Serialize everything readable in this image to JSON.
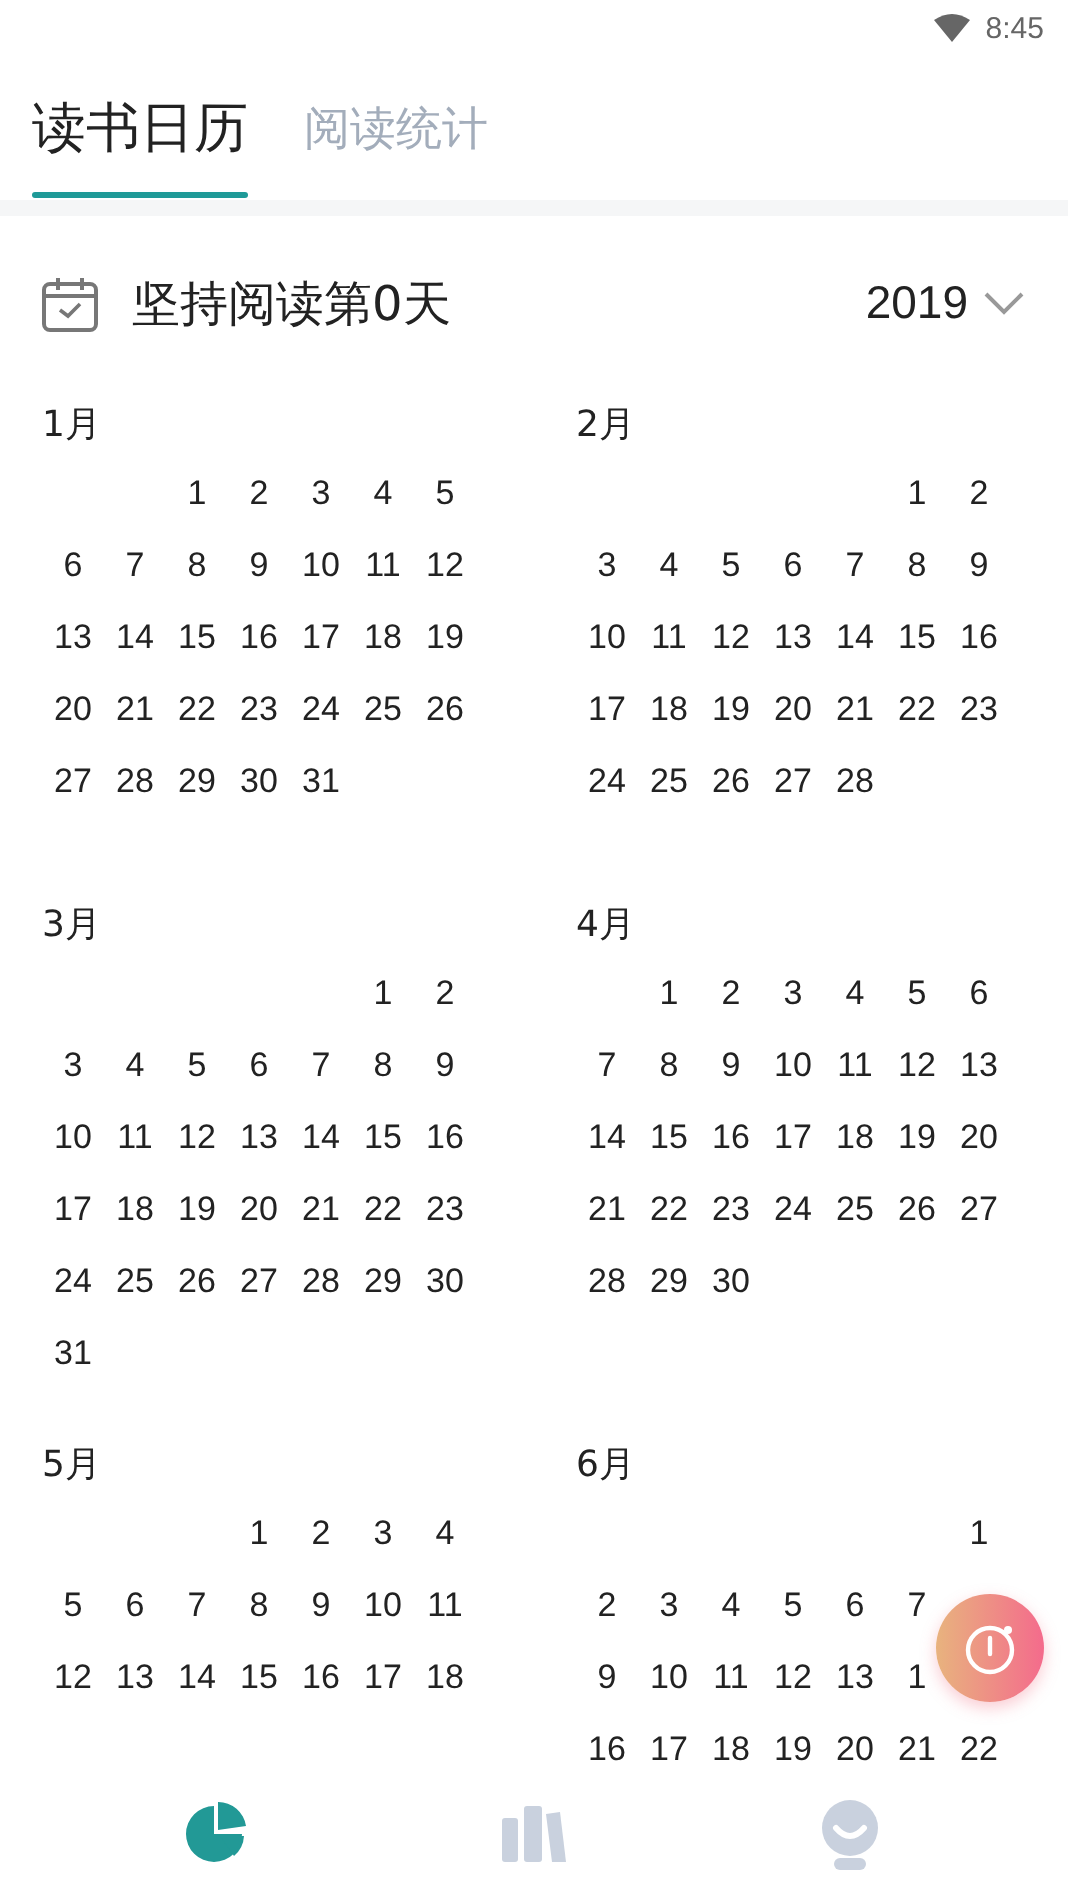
{
  "status_bar": {
    "time": "8:45"
  },
  "tabs": [
    {
      "label": "读书日历",
      "selected": true
    },
    {
      "label": "阅读统计",
      "selected": false
    }
  ],
  "header": {
    "title": "坚持阅读第0天",
    "year": "2019"
  },
  "months": [
    {
      "name": "1月",
      "weeks": [
        {
          "kind": "first",
          "days": [
            "1",
            "2",
            "3",
            "4",
            "5"
          ]
        },
        {
          "kind": "full",
          "days": [
            "6",
            "7",
            "8",
            "9",
            "10",
            "11",
            "12"
          ]
        },
        {
          "kind": "full",
          "days": [
            "13",
            "14",
            "15",
            "16",
            "17",
            "18",
            "19"
          ]
        },
        {
          "kind": "full",
          "days": [
            "20",
            "21",
            "22",
            "23",
            "24",
            "25",
            "26"
          ]
        },
        {
          "kind": "full",
          "days": [
            "27",
            "28",
            "29",
            "30",
            "31"
          ]
        }
      ]
    },
    {
      "name": "2月",
      "weeks": [
        {
          "kind": "first",
          "days": [
            "1",
            "2"
          ]
        },
        {
          "kind": "full",
          "days": [
            "3",
            "4",
            "5",
            "6",
            "7",
            "8",
            "9"
          ]
        },
        {
          "kind": "full",
          "days": [
            "10",
            "11",
            "12",
            "13",
            "14",
            "15",
            "16"
          ]
        },
        {
          "kind": "full",
          "days": [
            "17",
            "18",
            "19",
            "20",
            "21",
            "22",
            "23"
          ]
        },
        {
          "kind": "full",
          "days": [
            "24",
            "25",
            "26",
            "27",
            "28"
          ]
        }
      ]
    },
    {
      "name": "3月",
      "weeks": [
        {
          "kind": "first",
          "days": [
            "1",
            "2"
          ]
        },
        {
          "kind": "full",
          "days": [
            "3",
            "4",
            "5",
            "6",
            "7",
            "8",
            "9"
          ]
        },
        {
          "kind": "full",
          "days": [
            "10",
            "11",
            "12",
            "13",
            "14",
            "15",
            "16"
          ]
        },
        {
          "kind": "full",
          "days": [
            "17",
            "18",
            "19",
            "20",
            "21",
            "22",
            "23"
          ]
        },
        {
          "kind": "full",
          "days": [
            "24",
            "25",
            "26",
            "27",
            "28",
            "29",
            "30"
          ]
        },
        {
          "kind": "full",
          "days": [
            "31"
          ]
        }
      ]
    },
    {
      "name": "4月",
      "weeks": [
        {
          "kind": "first",
          "days": [
            "1",
            "2",
            "3",
            "4",
            "5",
            "6"
          ]
        },
        {
          "kind": "full",
          "days": [
            "7",
            "8",
            "9",
            "10",
            "11",
            "12",
            "13"
          ]
        },
        {
          "kind": "full",
          "days": [
            "14",
            "15",
            "16",
            "17",
            "18",
            "19",
            "20"
          ]
        },
        {
          "kind": "full",
          "days": [
            "21",
            "22",
            "23",
            "24",
            "25",
            "26",
            "27"
          ]
        },
        {
          "kind": "full",
          "days": [
            "28",
            "29",
            "30"
          ]
        }
      ]
    },
    {
      "name": "5月",
      "weeks": [
        {
          "kind": "first",
          "days": [
            "1",
            "2",
            "3",
            "4"
          ]
        },
        {
          "kind": "full",
          "days": [
            "5",
            "6",
            "7",
            "8",
            "9",
            "10",
            "11"
          ]
        },
        {
          "kind": "full",
          "days": [
            "12",
            "13",
            "14",
            "15",
            "16",
            "17",
            "18"
          ]
        }
      ]
    },
    {
      "name": "6月",
      "weeks": [
        {
          "kind": "first",
          "days": [
            "1"
          ]
        },
        {
          "kind": "full",
          "days": [
            "2",
            "3",
            "4",
            "5",
            "6",
            "7"
          ]
        },
        {
          "kind": "full",
          "days": [
            "9",
            "10",
            "11",
            "12",
            "13",
            "1"
          ]
        },
        {
          "kind": "full",
          "days": [
            "16",
            "17",
            "18",
            "19",
            "20",
            "21",
            "22"
          ]
        }
      ]
    }
  ],
  "bottom_nav": [
    {
      "selected": true
    },
    {
      "selected": false
    },
    {
      "selected": false
    }
  ]
}
